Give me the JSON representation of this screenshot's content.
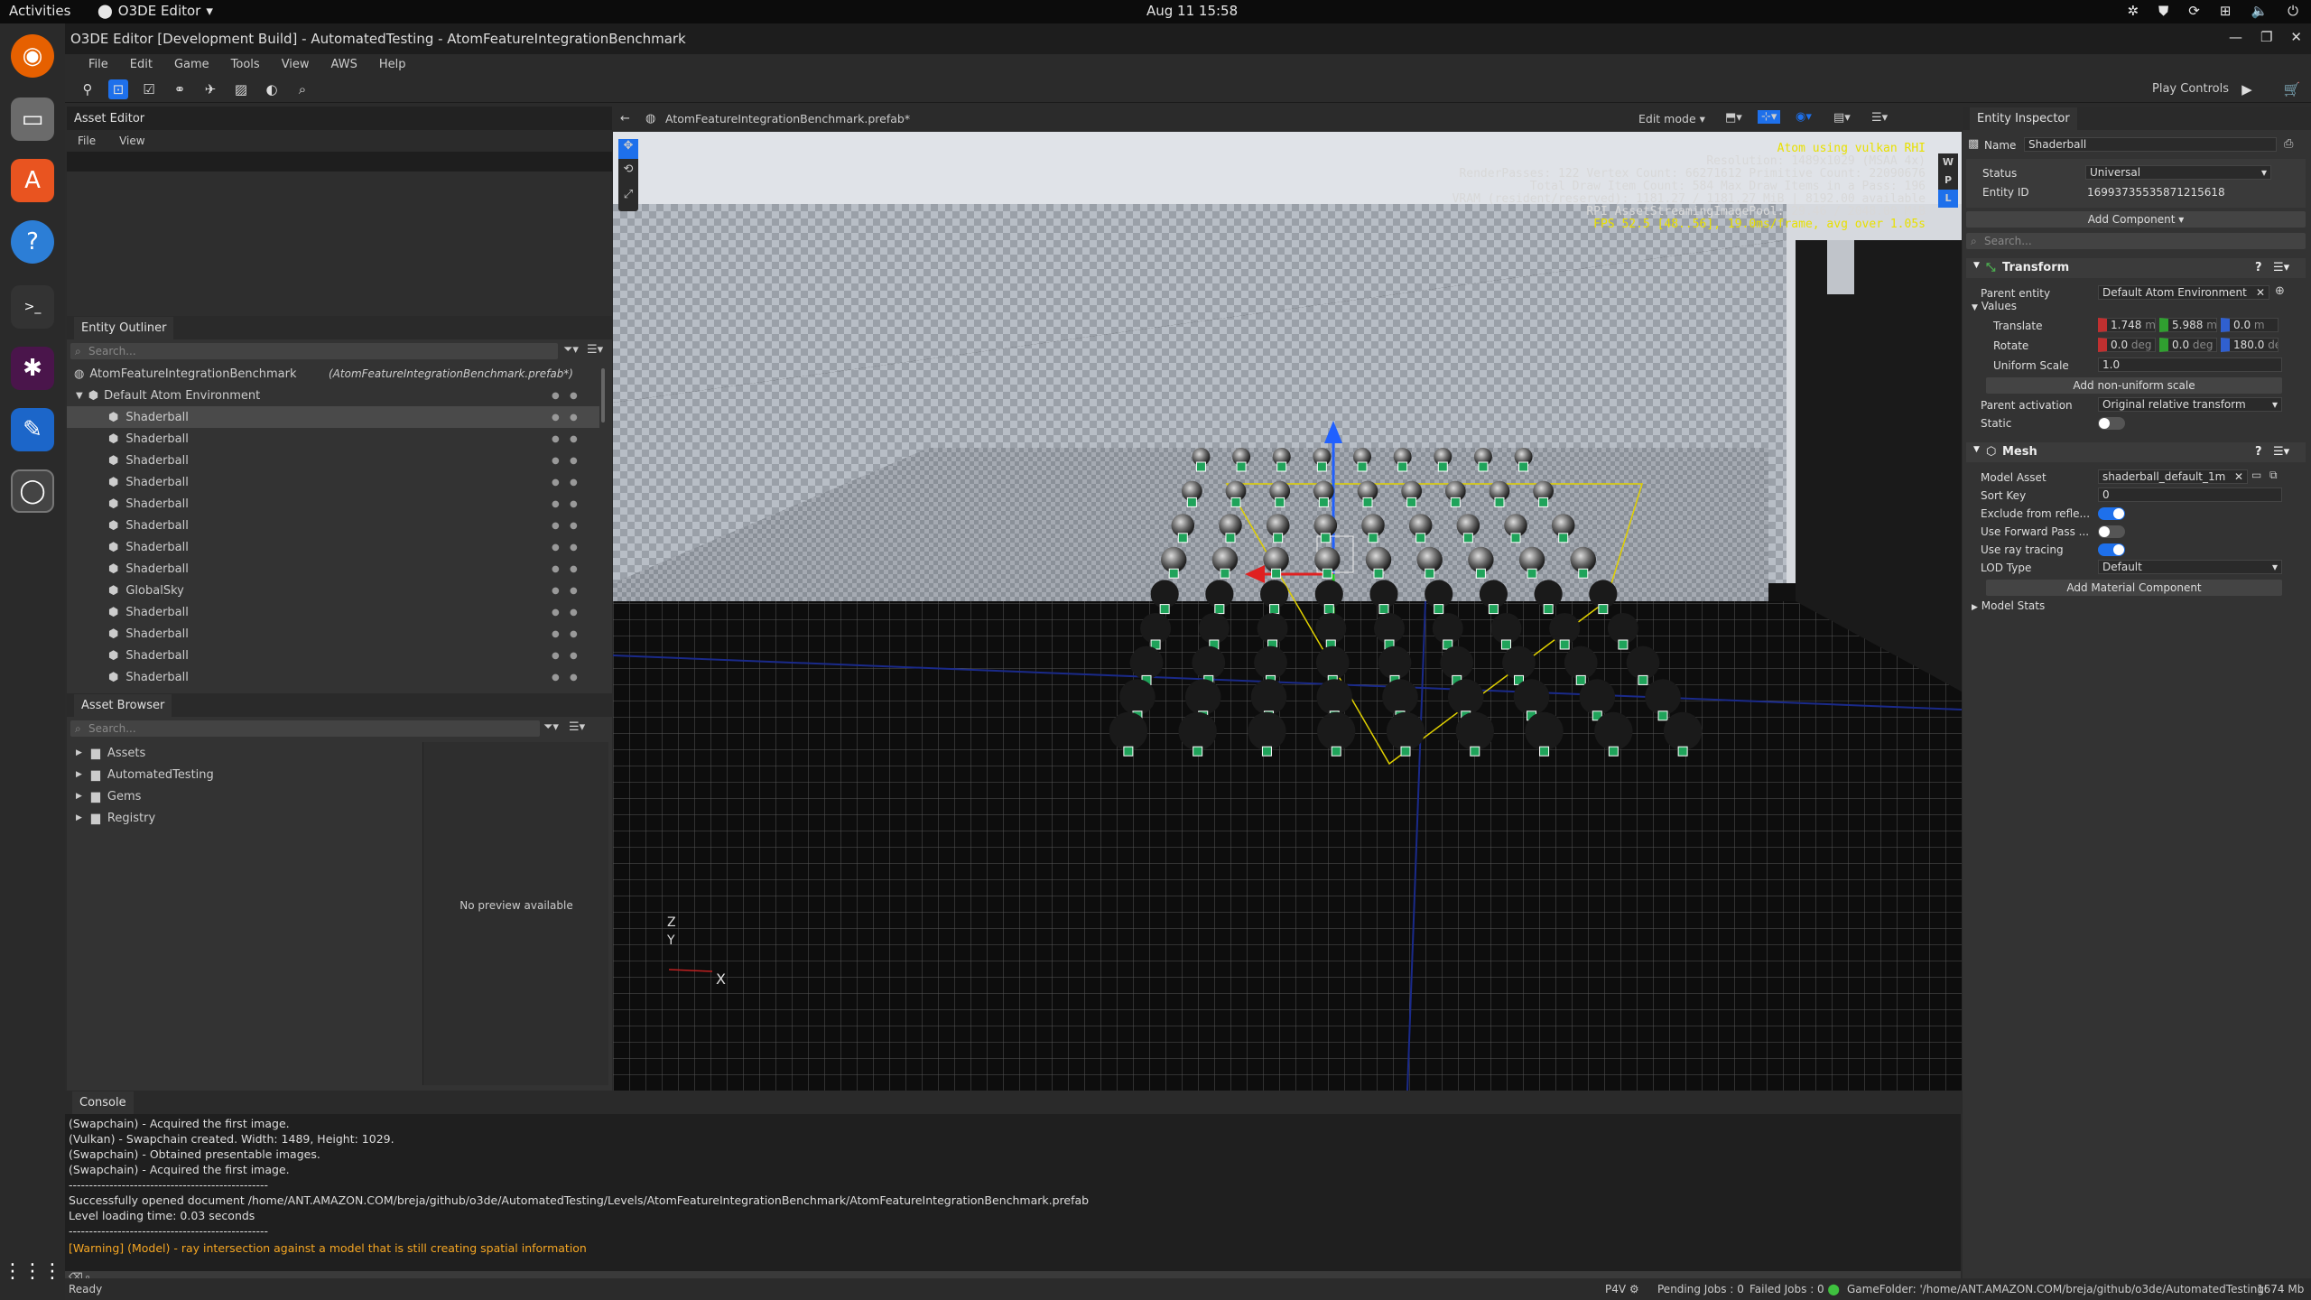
{
  "system": {
    "activities": "Activities",
    "app_name": "O3DE Editor",
    "clock": "Aug 11  15:58"
  },
  "window": {
    "title": "O3DE Editor [Development Build] - AutomatedTesting - AtomFeatureIntegrationBenchmark"
  },
  "menu": [
    "File",
    "Edit",
    "Game",
    "Tools",
    "View",
    "AWS",
    "Help"
  ],
  "toolbar": {
    "play_controls": "Play Controls"
  },
  "asset_editor": {
    "title": "Asset Editor",
    "menu": [
      "File",
      "View"
    ]
  },
  "outliner": {
    "title": "Entity Outliner",
    "search_placeholder": "Search...",
    "root": "AtomFeatureIntegrationBenchmark",
    "root_file": "(AtomFeatureIntegrationBenchmark.prefab*)",
    "group": "Default Atom Environment",
    "items": [
      "Shaderball",
      "Shaderball",
      "Shaderball",
      "Shaderball",
      "Shaderball",
      "Shaderball",
      "Shaderball",
      "Shaderball",
      "GlobalSky",
      "Shaderball",
      "Shaderball",
      "Shaderball",
      "Shaderball"
    ]
  },
  "asset_browser": {
    "title": "Asset Browser",
    "search_placeholder": "Search...",
    "folders": [
      "Assets",
      "AutomatedTesting",
      "Gems",
      "Registry"
    ],
    "preview": "No preview available"
  },
  "viewport": {
    "tab": "AtomFeatureIntegrationBenchmark.prefab*",
    "mode": "Edit mode",
    "hud": [
      "Atom using vulkan RHI",
      "Resolution: 1489x1029 (MSAA 4x)",
      "RenderPasses: 122 Vertex Count: 66271612 Primitive Count: 22090676",
      "Total Draw Item Count: 584  Max Draw Items in a Pass: 196",
      "VRAM (resident/reserved): 1181.27 / 1181.27 MiB | 8192.00 available",
      "RPI AssetStreamingImagePool: 29.46 / 2048.00 MiB",
      "FPS 52.5 [48..56], 19.0ms/frame, avg over 1.05s"
    ],
    "axis_z": "Z",
    "axis_y": "Y",
    "axis_x": "X",
    "side_buttons": [
      "W",
      "P",
      "L"
    ]
  },
  "inspector": {
    "title": "Entity Inspector",
    "name_label": "Name",
    "name_value": "Shaderball",
    "status_label": "Status",
    "status_value": "Universal",
    "entity_id_label": "Entity ID",
    "entity_id_value": "16993735535871215618",
    "add_component": "Add Component ▾",
    "search_placeholder": "Search...",
    "transform": {
      "title": "Transform",
      "parent_entity_label": "Parent entity",
      "parent_entity_value": "Default Atom Environment",
      "values_label": "Values",
      "translate_label": "Translate",
      "translate": [
        "1.748",
        "5.988",
        "0.0"
      ],
      "translate_unit": "m",
      "rotate_label": "Rotate",
      "rotate": [
        "0.0",
        "0.0",
        "180.0"
      ],
      "rotate_unit": "deg",
      "uniform_scale_label": "Uniform Scale",
      "uniform_scale": "1.0",
      "non_uniform_button": "Add non-uniform scale",
      "parent_activation_label": "Parent activation",
      "parent_activation_value": "Original relative transform",
      "static_label": "Static"
    },
    "mesh": {
      "title": "Mesh",
      "model_asset_label": "Model Asset",
      "model_asset_value": "shaderball_default_1m",
      "sort_key_label": "Sort Key",
      "sort_key_value": "0",
      "exclude_label": "Exclude from refle...",
      "forward_label": "Use Forward Pass ...",
      "raytracing_label": "Use ray tracing",
      "lod_label": "LOD Type",
      "lod_value": "Default",
      "add_material": "Add Material Component",
      "model_stats": "Model Stats"
    }
  },
  "console": {
    "title": "Console",
    "lines": [
      "(Swapchain) - Acquired the first image.",
      "(Vulkan) - Swapchain created. Width: 1489, Height: 1029.",
      "(Swapchain) - Obtained presentable images.",
      "(Swapchain) - Acquired the first image.",
      "-------------------------------------------------",
      "Successfully opened document /home/ANT.AMAZON.COM/breja/github/o3de/AutomatedTesting/Levels/AtomFeatureIntegrationBenchmark/AtomFeatureIntegrationBenchmark.prefab",
      "Level loading time: 0.03 seconds",
      "-------------------------------------------------"
    ],
    "warning": "[Warning] (Model) - ray intersection against a model that is still creating spatial information"
  },
  "status": {
    "ready": "Ready",
    "p4v": "P4V",
    "pending": "Pending Jobs : 0",
    "failed": "Failed Jobs : 0",
    "gamefolder": "GameFolder: '/home/ANT.AMAZON.COM/breja/github/o3de/AutomatedTesting'",
    "memory": "1674 Mb"
  },
  "colors": {
    "accent": "#1e70eb",
    "warning": "#f5a623",
    "hud_yellow": "#e8e000",
    "panel": "#333333"
  }
}
